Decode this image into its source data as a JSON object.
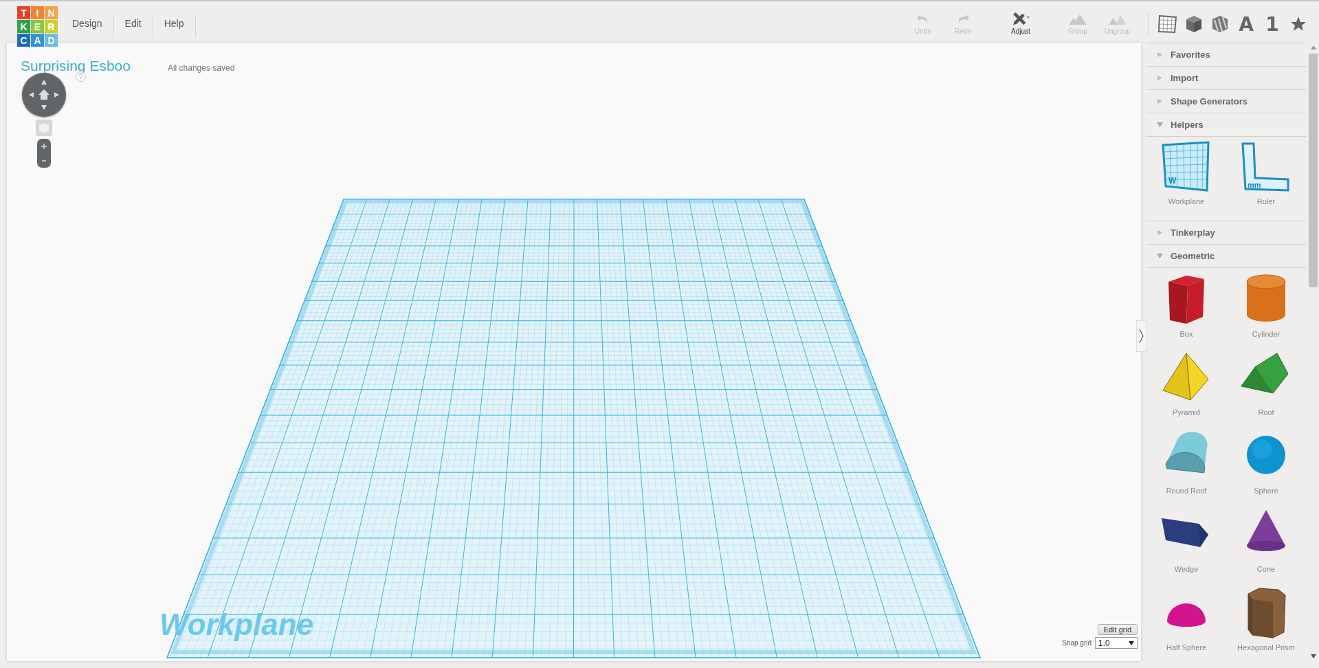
{
  "logo": {
    "letters": [
      {
        "char": "T",
        "color": "#e5412a"
      },
      {
        "char": "I",
        "color": "#f2843a"
      },
      {
        "char": "N",
        "color": "#f7a146"
      },
      {
        "char": "K",
        "color": "#27a54b"
      },
      {
        "char": "E",
        "color": "#8cc63e"
      },
      {
        "char": "R",
        "color": "#c7d22e"
      },
      {
        "char": "C",
        "color": "#1c6fb7"
      },
      {
        "char": "A",
        "color": "#3a92d1"
      },
      {
        "char": "D",
        "color": "#6bbce6"
      }
    ]
  },
  "menu": [
    {
      "label": "Design"
    },
    {
      "label": "Edit"
    },
    {
      "label": "Help"
    }
  ],
  "toolbar": [
    {
      "kind": "undo",
      "label": "Undo",
      "disabled": true
    },
    {
      "kind": "redo",
      "label": "Redo",
      "disabled": true
    },
    {
      "kind": "adjust",
      "label": "Adjust",
      "disabled": false
    },
    {
      "kind": "group",
      "label": "Group",
      "disabled": true
    },
    {
      "kind": "ungroup",
      "label": "Ungroup",
      "disabled": true
    }
  ],
  "view_tools": [
    {
      "kind": "grid"
    },
    {
      "kind": "box"
    },
    {
      "kind": "striped-box"
    },
    {
      "kind": "text",
      "label": "A"
    },
    {
      "kind": "text",
      "label": "1"
    },
    {
      "kind": "star"
    }
  ],
  "design": {
    "title": "Surprising Esboo",
    "save_status": "All changes saved"
  },
  "navigation": {
    "help": "?"
  },
  "workplane": {
    "label": "Workplane",
    "edit_grid": "Edit grid",
    "snap_grid_label": "Snap grid",
    "snap_grid_value": "1.0"
  },
  "sidebar": [
    {
      "label": "Favorites",
      "expanded": false
    },
    {
      "label": "Import",
      "expanded": false
    },
    {
      "label": "Shape Generators",
      "expanded": false
    },
    {
      "label": "Helpers",
      "expanded": true,
      "items": [
        {
          "kind": "workplane",
          "label": "Workplane",
          "mark": "W"
        },
        {
          "kind": "ruler",
          "label": "Ruler",
          "mark": "mm"
        }
      ]
    },
    {
      "label": "Tinkerplay",
      "expanded": false
    },
    {
      "label": "Geometric",
      "expanded": true,
      "items": [
        {
          "kind": "box",
          "label": "Box"
        },
        {
          "kind": "cylinder",
          "label": "Cylinder"
        },
        {
          "kind": "pyramid",
          "label": "Pyramid"
        },
        {
          "kind": "roof",
          "label": "Roof"
        },
        {
          "kind": "round-roof",
          "label": "Round Roof"
        },
        {
          "kind": "sphere",
          "label": "Sphere"
        },
        {
          "kind": "wedge",
          "label": "Wedge"
        },
        {
          "kind": "cone",
          "label": "Cone"
        },
        {
          "kind": "half-sphere",
          "label": "Half Sphere"
        },
        {
          "kind": "hexagonal-prism",
          "label": "Hexagonal Prism"
        }
      ]
    }
  ]
}
